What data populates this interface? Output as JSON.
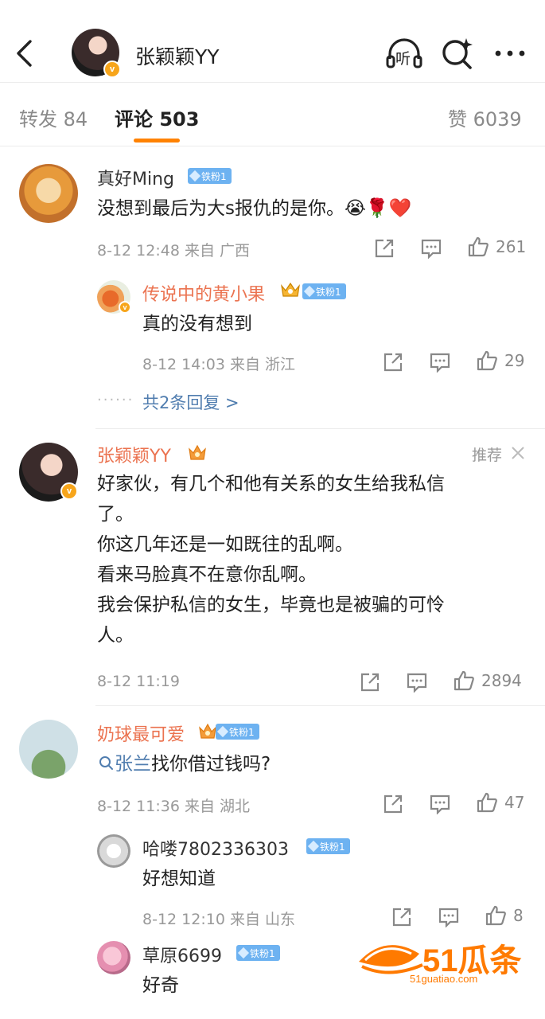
{
  "header": {
    "title": "张颖颖YY",
    "listen_label": "听",
    "verified": "v"
  },
  "tabs": [
    {
      "label": "转发 84"
    },
    {
      "label": "评论 503"
    },
    {
      "label": "赞 6039"
    }
  ],
  "comments": [
    {
      "name": "真好Ming",
      "fan_badge": "铁粉1",
      "text": "没想到最后为大s报仇的是你。😭🌹❤️",
      "meta": "8-12 12:48  来自 广西",
      "likes": "261",
      "replies": [
        {
          "name": "传说中的黄小果",
          "fan_badge": "铁粉1",
          "text": "真的没有想到",
          "meta": "8-12 14:03  来自 浙江",
          "likes": "29"
        }
      ],
      "more_replies": "共2条回复 >",
      "dots": "······"
    },
    {
      "name": "张颖颖YY",
      "recommend": "推荐",
      "text_lines": [
        "好家伙，有几个和他有关系的女生给我私信",
        "了。",
        "你这几年还是一如既往的乱啊。",
        "看来马脸真不在意你乱啊。",
        "我会保护私信的女生，毕竟也是被骗的可怜",
        "人。"
      ],
      "meta": "8-12 11:19",
      "likes": "2894"
    },
    {
      "name": "奶球最可爱",
      "fan_badge": "铁粉1",
      "mention": "张兰",
      "text": "找你借过钱吗?",
      "meta": "8-12 11:36  来自 湖北",
      "likes": "47",
      "replies": [
        {
          "name": "哈喽7802336303",
          "fan_badge": "铁粉1",
          "text": "好想知道",
          "meta": "8-12 12:10  来自 山东",
          "likes": "8"
        },
        {
          "name": "草原6699",
          "fan_badge": "铁粉1",
          "text": "好奇"
        }
      ]
    }
  ],
  "watermark": {
    "brand": "51瓜条",
    "url": "51guatiao.com"
  },
  "colors": {
    "accent": "#ff8200",
    "link": "#507daf",
    "name_orange": "#eb7350",
    "fan_badge": "#6db2f1"
  }
}
